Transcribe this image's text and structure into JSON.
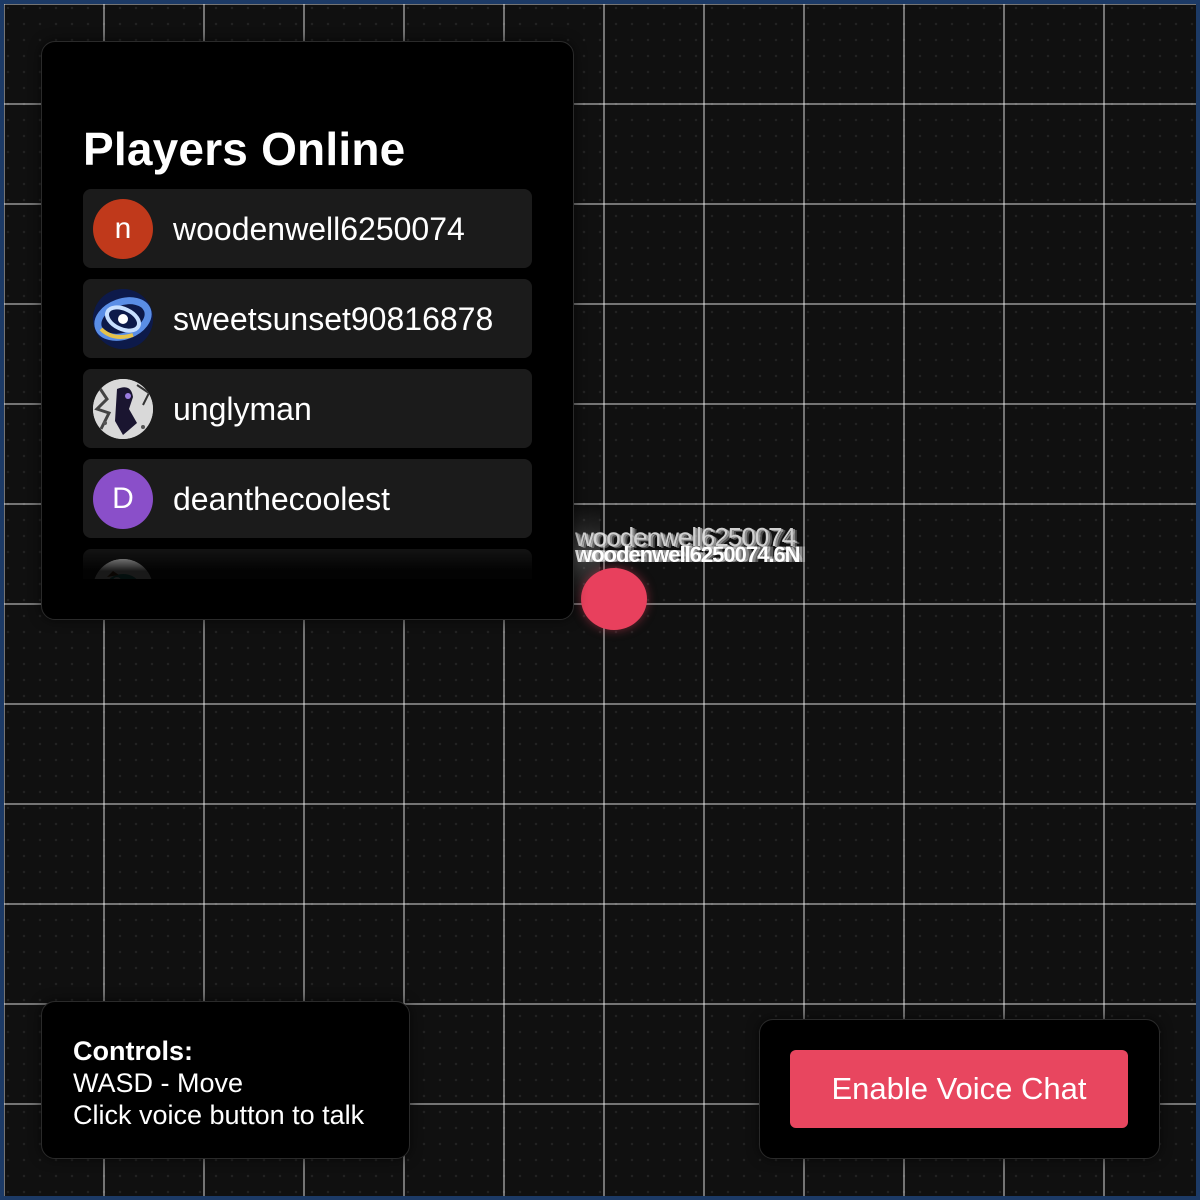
{
  "players_panel": {
    "title": "Players Online",
    "players": [
      {
        "name": "woodenwell6250074",
        "avatar_type": "initial",
        "avatar_initial": "n",
        "avatar_color": "#c0391b"
      },
      {
        "name": "sweetsunset90816878",
        "avatar_type": "image",
        "avatar_icon": "galaxy-swirl-icon"
      },
      {
        "name": "unglyman",
        "avatar_type": "image",
        "avatar_icon": "abstract-figure-icon"
      },
      {
        "name": "deanthecoolest",
        "avatar_type": "initial",
        "avatar_initial": "D",
        "avatar_color": "#8a4fc9"
      },
      {
        "name": "",
        "avatar_type": "image",
        "avatar_icon": "platypus-icon"
      }
    ]
  },
  "game": {
    "player_label": "woodenwell6250074",
    "player_coords": "woodenwell6250074.6N",
    "player_color": "#e8405d",
    "grid_line_color": "#6b6b6b",
    "border_color": "#1c3a66"
  },
  "controls": {
    "heading": "Controls:",
    "lines": [
      "WASD - Move",
      "Click voice button to talk"
    ]
  },
  "voice": {
    "button_label": "Enable Voice Chat",
    "button_color": "#e8465f"
  }
}
